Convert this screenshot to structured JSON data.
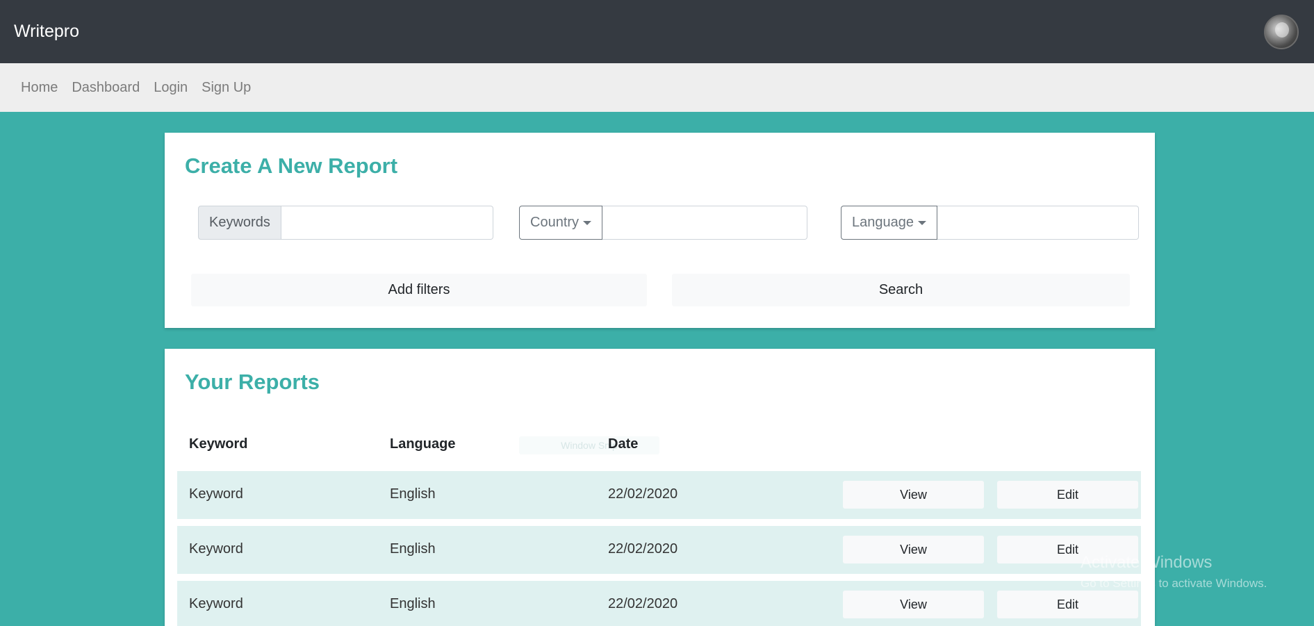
{
  "header": {
    "brand": "Writepro"
  },
  "nav": {
    "items": [
      "Home",
      "Dashboard",
      "Login",
      "Sign Up"
    ]
  },
  "create_report": {
    "title": "Create A New Report",
    "keywords_label": "Keywords",
    "keywords_value": "",
    "country_label": "Country",
    "country_value": "",
    "language_label": "Language",
    "language_value": "",
    "add_filters_label": "Add filters",
    "search_label": "Search"
  },
  "reports": {
    "title": "Your Reports",
    "columns": [
      "Keyword",
      "Language",
      "Date"
    ],
    "ghost_button_label": "Window Snip",
    "rows": [
      {
        "keyword": "Keyword",
        "language": "English",
        "date": "22/02/2020",
        "view_label": "View",
        "edit_label": "Edit"
      },
      {
        "keyword": "Keyword",
        "language": "English",
        "date": "22/02/2020",
        "view_label": "View",
        "edit_label": "Edit"
      },
      {
        "keyword": "Keyword",
        "language": "English",
        "date": "22/02/2020",
        "view_label": "View",
        "edit_label": "Edit"
      }
    ]
  },
  "watermark": {
    "title": "Activate Windows",
    "subtitle": "Go to Settings to activate Windows."
  },
  "colors": {
    "accent": "#3cafa8",
    "topbar": "#353a41",
    "navbar": "#eeeeee",
    "row_bg": "#dff1f0"
  }
}
